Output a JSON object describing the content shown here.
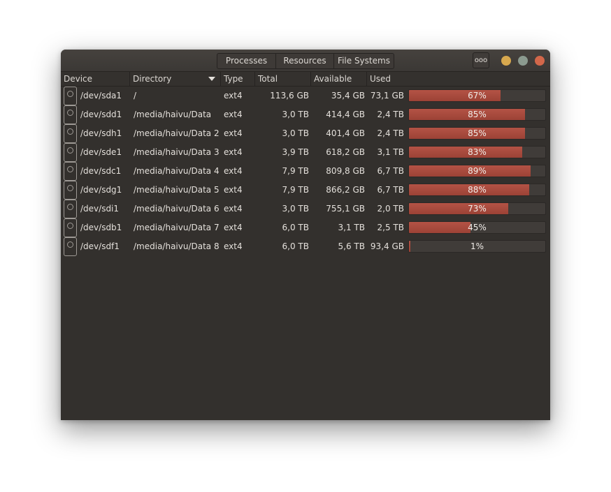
{
  "tabs": [
    "Processes",
    "Resources",
    "File Systems"
  ],
  "titlebar": {
    "menu_icon": "ooo"
  },
  "columns": {
    "device": "Device",
    "directory": "Directory",
    "type": "Type",
    "total": "Total",
    "available": "Available",
    "used": "Used"
  },
  "colors": {
    "used_bar": "#a74a3d",
    "background": "#33302d"
  },
  "rows": [
    {
      "device": "/dev/sda1",
      "directory": "/",
      "type": "ext4",
      "total": "113,6  GB",
      "available": "35,4  GB",
      "used": "73,1  GB",
      "percent_label": "67%",
      "percent": 67
    },
    {
      "device": "/dev/sdd1",
      "directory": "/media/haivu/Data",
      "type": "ext4",
      "total": "3,0  TB",
      "available": "414,4  GB",
      "used": "2,4  TB",
      "percent_label": "85%",
      "percent": 85
    },
    {
      "device": "/dev/sdh1",
      "directory": "/media/haivu/Data 2",
      "type": "ext4",
      "total": "3,0  TB",
      "available": "401,4  GB",
      "used": "2,4  TB",
      "percent_label": "85%",
      "percent": 85
    },
    {
      "device": "/dev/sde1",
      "directory": "/media/haivu/Data 3",
      "type": "ext4",
      "total": "3,9  TB",
      "available": "618,2  GB",
      "used": "3,1  TB",
      "percent_label": "83%",
      "percent": 83
    },
    {
      "device": "/dev/sdc1",
      "directory": "/media/haivu/Data 4",
      "type": "ext4",
      "total": "7,9  TB",
      "available": "809,8  GB",
      "used": "6,7  TB",
      "percent_label": "89%",
      "percent": 89
    },
    {
      "device": "/dev/sdg1",
      "directory": "/media/haivu/Data 5",
      "type": "ext4",
      "total": "7,9  TB",
      "available": "866,2  GB",
      "used": "6,7  TB",
      "percent_label": "88%",
      "percent": 88
    },
    {
      "device": "/dev/sdi1",
      "directory": "/media/haivu/Data 6",
      "type": "ext4",
      "total": "3,0  TB",
      "available": "755,1  GB",
      "used": "2,0  TB",
      "percent_label": "73%",
      "percent": 73
    },
    {
      "device": "/dev/sdb1",
      "directory": "/media/haivu/Data 7",
      "type": "ext4",
      "total": "6,0  TB",
      "available": "3,1  TB",
      "used": "2,5  TB",
      "percent_label": "45%",
      "percent": 45
    },
    {
      "device": "/dev/sdf1",
      "directory": "/media/haivu/Data 8",
      "type": "ext4",
      "total": "6,0  TB",
      "available": "5,6  TB",
      "used": "93,4  GB",
      "percent_label": "1%",
      "percent": 1
    }
  ]
}
